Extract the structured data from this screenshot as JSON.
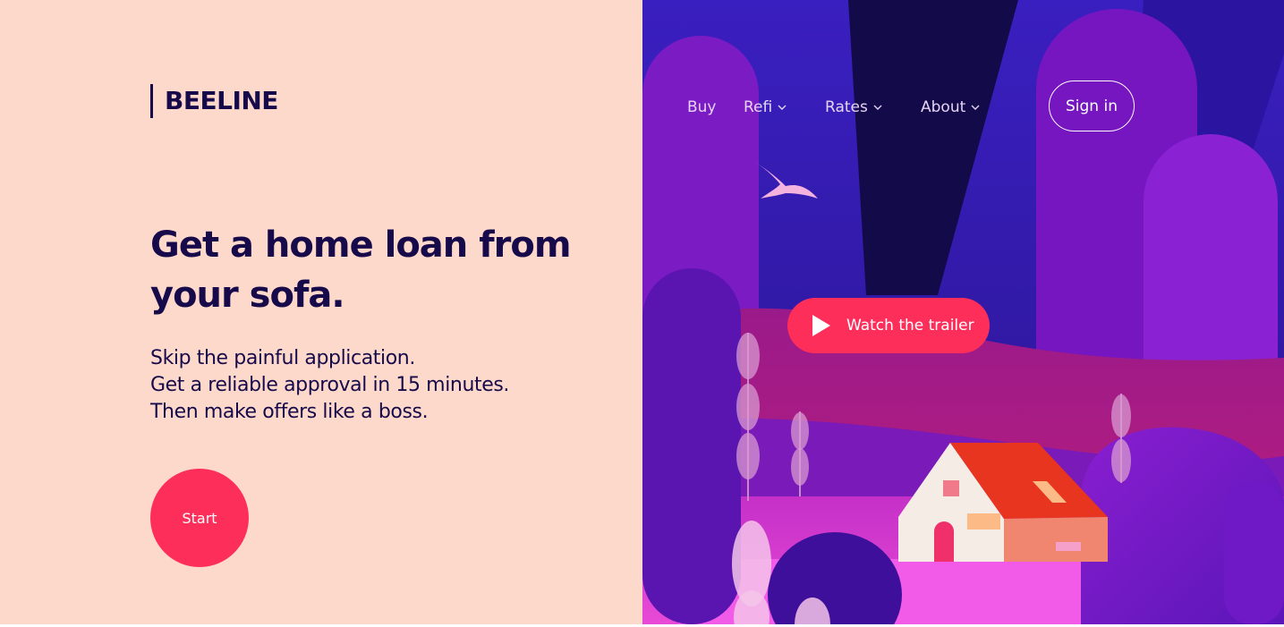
{
  "brand": {
    "name": "BEELINE"
  },
  "hero": {
    "headline_line1": "Get a home loan from",
    "headline_line2": "your sofa.",
    "sub_line1": "Skip the painful application.",
    "sub_line2": "Get a reliable approval in 15 minutes.",
    "sub_line3": "Then make offers like a boss.",
    "start_label": "Start"
  },
  "nav": {
    "items": [
      {
        "label": "Buy",
        "icon": null
      },
      {
        "label": "Refi",
        "icon": "chevron-down-icon"
      },
      {
        "label": "Rates",
        "icon": "chevron-down-icon"
      },
      {
        "label": "About",
        "icon": "chevron-down-icon"
      }
    ],
    "signin_label": "Sign in"
  },
  "media": {
    "trailer_label": "Watch the trailer",
    "trailer_icon": "play-icon"
  },
  "colors": {
    "background_left": "#fdd9cb",
    "text_dark": "#170a4a",
    "accent": "#fe2e5b",
    "nav_text": "#e6d4f4"
  }
}
